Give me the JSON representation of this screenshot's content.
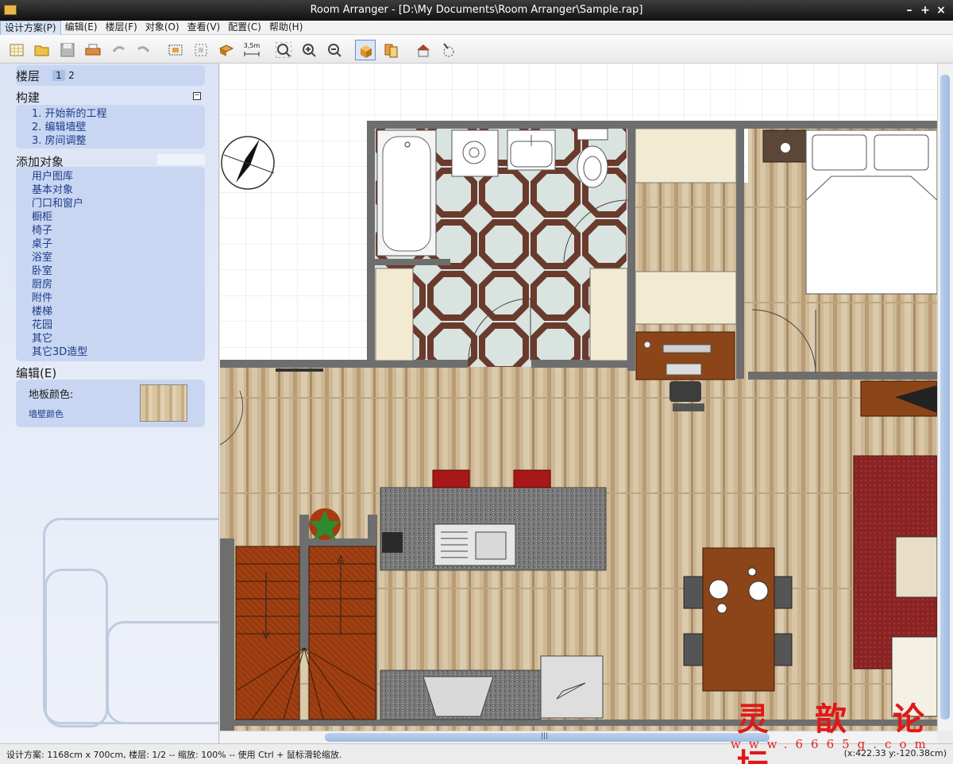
{
  "window": {
    "title": "Room Arranger - [D:\\My Documents\\Room Arranger\\Sample.rap]",
    "minimize": "–",
    "maximize": "+",
    "close": "×"
  },
  "menu": [
    "设计方案(P)",
    "编辑(E)",
    "楼层(F)",
    "对象(O)",
    "查看(V)",
    "配置(C)",
    "帮助(H)"
  ],
  "toolbar": {
    "dim_label": "3,5m",
    "buttons": [
      "new-plan-icon",
      "open-icon",
      "save-icon",
      "print-icon",
      "undo-icon",
      "redo-icon",
      "edit-room-icon",
      "select-icon",
      "objects-icon",
      "measure-icon",
      "zoom-fit-icon",
      "zoom-in-icon",
      "zoom-out-icon",
      "3d-view-icon",
      "copy-object-icon",
      "house-3d-icon",
      "walk-icon"
    ]
  },
  "sidebar": {
    "floors": {
      "title": "楼层",
      "items": [
        "1",
        "2"
      ],
      "selected": "1"
    },
    "build": {
      "title": "构建",
      "collapse": "−",
      "items": [
        "1. 开始新的工程",
        "2. 编辑墙壁",
        "3. 房间调整"
      ]
    },
    "add_objects": {
      "title": "添加对象",
      "items": [
        "用户图库",
        "基本对象",
        "门口和窗户",
        "橱柜",
        "椅子",
        "桌子",
        "浴室",
        "卧室",
        "厨房",
        "附件",
        "楼梯",
        "花园",
        "其它",
        "其它3D造型"
      ]
    },
    "edit": {
      "title": "编辑(E)",
      "floor_color": "地板颜色:",
      "wall_color": "墙壁颜色"
    }
  },
  "status": {
    "left": "设计方案: 1168cm x 700cm, 楼层: 1/2 -- 缩放: 100% -- 使用 Ctrl + 鼠标滑轮缩放.",
    "right": "(x:422.33 y:-120.38cm)"
  },
  "watermark": {
    "big": "灵 歆 论 坛",
    "small": "www.6665g.com"
  },
  "scroll": {
    "grip": "|||"
  },
  "colors": {
    "wall": "#6e6e6e",
    "wood": "#c8b08c",
    "stairs": "#9a3c12",
    "counter": "#6f6f6f",
    "rug": "#8b2626",
    "table": "#8b4513"
  }
}
